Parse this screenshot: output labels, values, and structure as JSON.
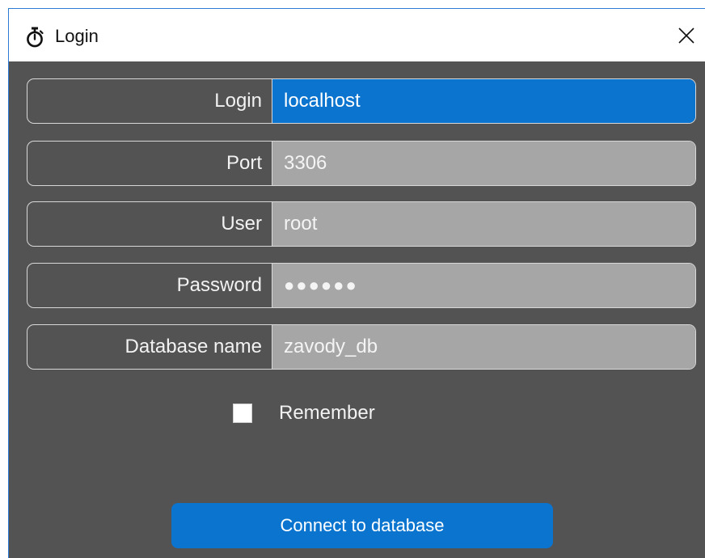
{
  "window": {
    "title": "Login",
    "icon": "stopwatch-icon",
    "close_icon": "close-icon"
  },
  "form": {
    "fields": [
      {
        "label": "Login",
        "value": "localhost",
        "focused": true
      },
      {
        "label": "Port",
        "value": "3306"
      },
      {
        "label": "User",
        "value": "root"
      },
      {
        "label": "Password",
        "value": "●●●●●●"
      },
      {
        "label": "Database name",
        "value": "zavody_db"
      }
    ],
    "remember_label": "Remember",
    "remember_checked": false,
    "connect_label": "Connect to database"
  },
  "colors": {
    "window_bg": "#535353",
    "input_bg": "#a6a6a6",
    "accent": "#0a74cf"
  }
}
